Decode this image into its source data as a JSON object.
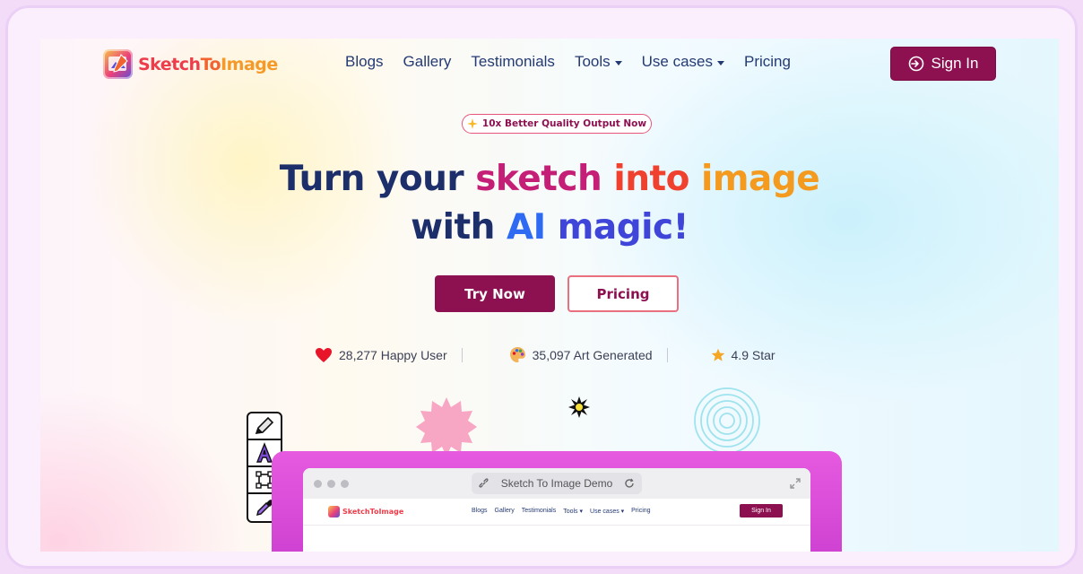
{
  "brand": {
    "name_part1": "Sketch",
    "name_part2": "To",
    "name_part3": "Image"
  },
  "nav": {
    "items": [
      {
        "label": "Blogs",
        "dropdown": false
      },
      {
        "label": "Gallery",
        "dropdown": false
      },
      {
        "label": "Testimonials",
        "dropdown": false
      },
      {
        "label": "Tools",
        "dropdown": true
      },
      {
        "label": "Use cases",
        "dropdown": true
      },
      {
        "label": "Pricing",
        "dropdown": false
      }
    ],
    "signin_label": "Sign In"
  },
  "badge": {
    "icon": "sparkle-icon",
    "text": "10x Better Quality Output Now"
  },
  "hero": {
    "line1": {
      "w1": "Turn your",
      "w2": "sketch",
      "w3": "into",
      "w4": "image"
    },
    "line2": {
      "w1": "with",
      "w2": "AI",
      "w3": "magic!"
    }
  },
  "cta": {
    "primary": "Try Now",
    "secondary": "Pricing"
  },
  "stats": [
    {
      "icon": "heart-icon",
      "text": "28,277 Happy User"
    },
    {
      "icon": "palette-icon",
      "text": "35,097 Art Generated"
    },
    {
      "icon": "star-icon",
      "text": "4.9 Star"
    }
  ],
  "colors": {
    "primary": "#8d1051",
    "navy": "#1d2f6b",
    "accent_pink": "#c41e76",
    "accent_red": "#f0402e",
    "accent_orange": "#f39a1f",
    "accent_blue": "#2f6bf2"
  },
  "demo": {
    "url_text": "Sketch To Image Demo",
    "mini_brand": "SketchToImage",
    "mini_links": [
      "Blogs",
      "Gallery",
      "Testimonials",
      "Tools ▾",
      "Use cases ▾",
      "Pricing"
    ],
    "mini_signin": "Sign In"
  }
}
